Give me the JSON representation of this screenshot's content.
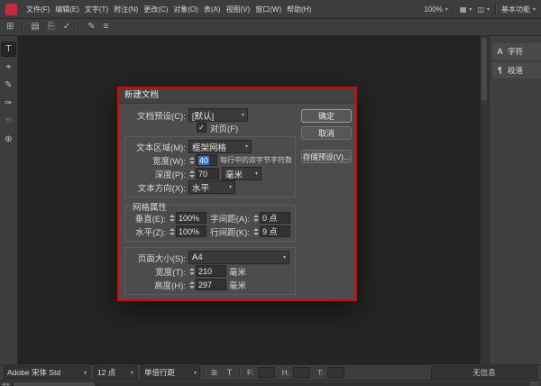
{
  "colors": {
    "selection_blue": "#2e73d2",
    "annotation_red": "#e60000",
    "app_icon_red": "#c9283d"
  },
  "menubar": {
    "items": [
      "文件(F)",
      "编辑(E)",
      "文字(T)",
      "附注(N)",
      "更改(C)",
      "对象(O)",
      "表(A)",
      "视图(V)",
      "窗口(W)",
      "帮助(H)"
    ],
    "zoom": "100%",
    "view_options_glyph": "▦",
    "screen_mode_glyph": "◫",
    "workspace": "基本功能"
  },
  "toolbar": {
    "icons": [
      {
        "name": "bridge-icon",
        "glyph": "⊞"
      },
      {
        "name": "save-icon",
        "glyph": "▤"
      },
      {
        "name": "print-icon",
        "glyph": "⎘"
      },
      {
        "name": "spellcheck-icon",
        "glyph": "✓"
      },
      {
        "name": "note-icon",
        "glyph": "✎"
      },
      {
        "name": "track-changes-icon",
        "glyph": "≡"
      }
    ]
  },
  "toolbox": {
    "tools": [
      {
        "name": "type-tool",
        "glyph": "T"
      },
      {
        "name": "position-tool",
        "glyph": "⌖"
      },
      {
        "name": "note-tool",
        "glyph": "✎"
      },
      {
        "name": "eyedropper-tool",
        "glyph": "✑"
      },
      {
        "name": "hand-tool",
        "glyph": "☜"
      },
      {
        "name": "zoom-tool",
        "glyph": "⊕"
      }
    ]
  },
  "dock": {
    "panels": [
      {
        "icon": "A",
        "label": "字符"
      },
      {
        "icon": "¶",
        "label": "段落"
      }
    ]
  },
  "dialog": {
    "title": "新建文档",
    "preset_label": "文档预设(C):",
    "preset_value": "[默认]",
    "facing_pages_label": "对页(F)",
    "checkbox_glyph": "✓",
    "buttons": {
      "ok": "确定",
      "cancel": "取消",
      "save_preset": "存储预设(V)..."
    },
    "text_area": {
      "label": "文本区域(M):",
      "value": "框架网格",
      "width_label": "宽度(W):",
      "width_value": "40",
      "width_hint": "每行中的双字节字符数",
      "depth_label": "深度(P):",
      "depth_value": "70",
      "depth_unit": "毫米",
      "direction_label": "文本方向(X):",
      "direction_value": "水平"
    },
    "grid": {
      "title": "网格属性",
      "vertical_label": "垂直(E):",
      "vertical_value": "100%",
      "horizontal_label": "水平(Z):",
      "horizontal_value": "100%",
      "char_spacing_label": "字间距(A):",
      "char_spacing_value": "0 点",
      "line_spacing_label": "行间距(K):",
      "line_spacing_value": "9 点"
    },
    "page": {
      "size_label": "页面大小(S):",
      "size_value": "A4",
      "width_label": "宽度(T):",
      "width_value": "210",
      "width_unit": "毫米",
      "height_label": "高度(H):",
      "height_value": "297",
      "height_unit": "毫米"
    }
  },
  "controlbar": {
    "font_name": "Adobe 宋体 Std",
    "font_size": "12 点",
    "leading": "单倍行距",
    "icons": [
      {
        "name": "story-editor-icon",
        "glyph": "≣"
      },
      {
        "name": "text-macro-icon",
        "glyph": "T"
      }
    ],
    "fields": [
      {
        "label": "F:"
      },
      {
        "label": "H:"
      },
      {
        "label": "T:"
      }
    ],
    "status": "无信息"
  }
}
